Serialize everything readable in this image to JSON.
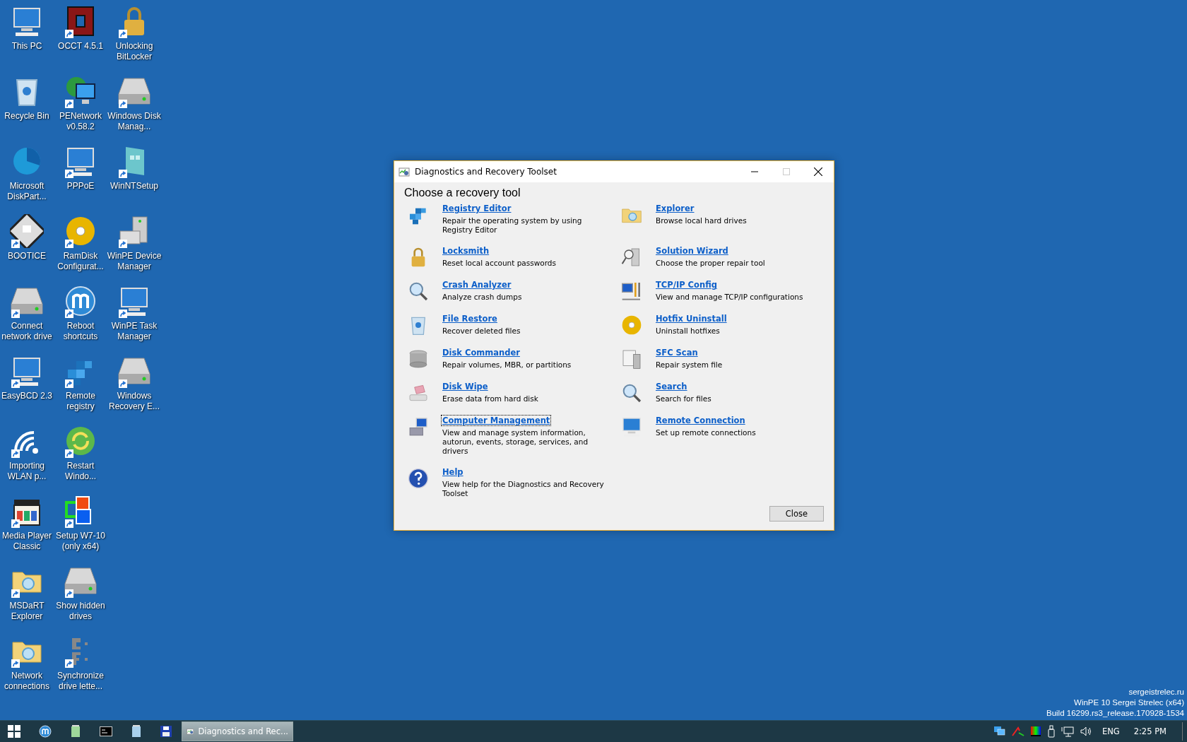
{
  "desktop_icons": [
    {
      "label": "This PC",
      "shortcut": false
    },
    {
      "label": "Recycle Bin",
      "shortcut": false
    },
    {
      "label": "Microsoft DiskPart...",
      "shortcut": false
    },
    {
      "label": "BOOTICE",
      "shortcut": true
    },
    {
      "label": "Connect network drive",
      "shortcut": true
    },
    {
      "label": "EasyBCD 2.3",
      "shortcut": true
    },
    {
      "label": "Importing WLAN p...",
      "shortcut": true
    },
    {
      "label": "Media Player Classic",
      "shortcut": true
    },
    {
      "label": "MSDaRT Explorer",
      "shortcut": true
    },
    {
      "label": "Network connections",
      "shortcut": true
    },
    {
      "label": "OCCT 4.5.1",
      "shortcut": true
    },
    {
      "label": "PENetwork v0.58.2",
      "shortcut": true
    },
    {
      "label": "PPPoE",
      "shortcut": true
    },
    {
      "label": "RamDisk Configurat...",
      "shortcut": true
    },
    {
      "label": "Reboot shortcuts",
      "shortcut": true
    },
    {
      "label": "Remote registry",
      "shortcut": true
    },
    {
      "label": "Restart Windo...",
      "shortcut": true
    },
    {
      "label": "Setup W7-10 (only x64)",
      "shortcut": true
    },
    {
      "label": "Show hidden drives",
      "shortcut": true
    },
    {
      "label": "Synchronize drive lette...",
      "shortcut": true
    },
    {
      "label": "Unlocking BitLocker",
      "shortcut": true
    },
    {
      "label": "Windows Disk Manag...",
      "shortcut": true
    },
    {
      "label": "WinNTSetup",
      "shortcut": true
    },
    {
      "label": "WinPE Device Manager",
      "shortcut": true
    },
    {
      "label": "WinPE Task Manager",
      "shortcut": true
    },
    {
      "label": "Windows Recovery E...",
      "shortcut": true
    }
  ],
  "desktop_info": [
    "sergeistrelec.ru",
    "WinPE 10 Sergei Strelec (x64)",
    "Build 16299.rs3_release.170928-1534"
  ],
  "dialog": {
    "title": "Diagnostics and Recovery Toolset",
    "heading": "Choose a recovery tool",
    "tools_left": [
      {
        "title": "Registry Editor",
        "description": "Repair the operating system by using Registry Editor",
        "focused": false
      },
      {
        "title": "Locksmith",
        "description": "Reset local account passwords",
        "focused": false
      },
      {
        "title": "Crash Analyzer",
        "description": "Analyze crash dumps",
        "focused": false
      },
      {
        "title": "File Restore",
        "description": "Recover deleted files",
        "focused": false
      },
      {
        "title": "Disk Commander",
        "description": "Repair volumes, MBR, or partitions",
        "focused": false
      },
      {
        "title": "Disk Wipe",
        "description": "Erase data from hard disk",
        "focused": false
      },
      {
        "title": "Computer Management",
        "description": "View and manage system information, autorun, events, storage, services, and drivers",
        "focused": true
      },
      {
        "title": "Help",
        "description": "View help for the Diagnostics and Recovery Toolset",
        "focused": false
      }
    ],
    "tools_right": [
      {
        "title": "Explorer",
        "description": "Browse local hard drives",
        "focused": false
      },
      {
        "title": "Solution Wizard",
        "description": "Choose the proper repair tool",
        "focused": false
      },
      {
        "title": "TCP/IP Config",
        "description": "View and manage TCP/IP configurations",
        "focused": false
      },
      {
        "title": "Hotfix Uninstall",
        "description": "Uninstall hotfixes",
        "focused": false
      },
      {
        "title": "SFC Scan",
        "description": "Repair system file",
        "focused": false
      },
      {
        "title": "Search",
        "description": "Search for files",
        "focused": false
      },
      {
        "title": "Remote Connection",
        "description": "Set up remote connections",
        "focused": false
      }
    ],
    "close_button": "Close"
  },
  "taskbar": {
    "task_button": {
      "label": "Diagnostics and Rec...",
      "selected": true
    },
    "language": "ENG",
    "time": "2:25 PM"
  }
}
